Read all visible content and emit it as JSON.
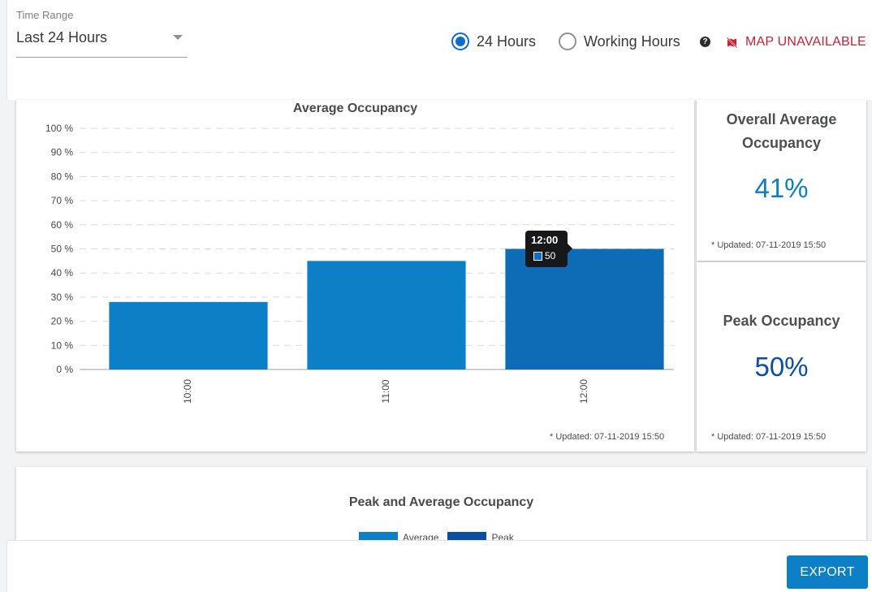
{
  "filters": {
    "time_range_label": "Time Range",
    "time_range_value": "Last 24 Hours",
    "radio_24h": "24 Hours",
    "radio_working": "Working Hours",
    "radio_selected": "24 Hours",
    "help_glyph": "?",
    "map_status": "MAP UNAVAILABLE"
  },
  "colors": {
    "accent": "#0d6ec7",
    "bar": "#0d7fc7",
    "bar_highlight": "#0e6bb6",
    "peak": "#0b4fa3",
    "warning": "#cf2030"
  },
  "chart_data": {
    "type": "bar",
    "title": "Average Occupancy",
    "categories": [
      "10:00",
      "11:00",
      "12:00"
    ],
    "values": [
      28,
      45,
      50
    ],
    "yticks": [
      "100 %",
      "90 %",
      "80 %",
      "70 %",
      "60 %",
      "50 %",
      "40 %",
      "30 %",
      "20 %",
      "10 %",
      "0 %"
    ],
    "ylim": [
      0,
      100
    ],
    "grid": true,
    "highlighted": "12:00"
  },
  "tooltip": {
    "time": "12:00",
    "value": "50"
  },
  "main_card": {
    "updated": "* Updated: 07-11-2019 15:50"
  },
  "overall_card": {
    "title": "Overall Average Occupancy",
    "value": "41%",
    "updated": "* Updated: 07-11-2019 15:50"
  },
  "peak_card": {
    "title": "Peak Occupancy",
    "value": "50%",
    "updated": "* Updated: 07-11-2019 15:50"
  },
  "second_card": {
    "title": "Peak and Average Occupancy",
    "legend": [
      "Average",
      "Peak"
    ]
  },
  "footer": {
    "export_label": "EXPORT"
  }
}
